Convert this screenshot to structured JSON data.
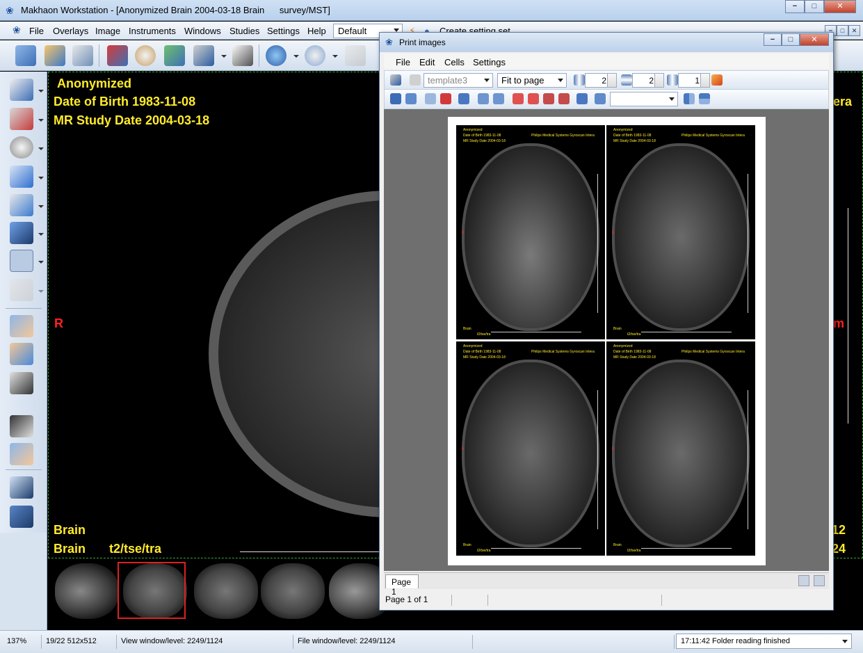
{
  "window": {
    "title": "Makhaon Workstation - [Anonymized Brain 2004-03-18 Brain      survey/MST]",
    "min": "−",
    "max": "□",
    "close": "✕"
  },
  "menu": {
    "file": "File",
    "overlays": "Overlays",
    "image": "Image",
    "instruments": "Instruments",
    "windows": "Windows",
    "studies": "Studies",
    "settings": "Settings",
    "help": "Help",
    "layout_value": "Default",
    "create_setting_set": "Create setting set"
  },
  "overlay": {
    "name": "Anonymized",
    "dob": "Date of Birth 1983-11-08",
    "study_date": "MR Study Date 2004-03-18",
    "orientation_left": "R",
    "orientation_right": "m",
    "body_part": "Brain",
    "series_body": "Brain",
    "series_desc": "t2/tse/tra",
    "right_top": "era",
    "right_mid": "12",
    "right_bottom": "24"
  },
  "status": {
    "zoom": "137%",
    "image_info": "19/22 512x512",
    "view_wl": "View window/level: 2249/1124",
    "file_wl": "File window/level: 2249/1124",
    "log": "17:11:42 Folder reading finished"
  },
  "print_dialog": {
    "title": "Print images",
    "menu": {
      "file": "File",
      "edit": "Edit",
      "cells": "Cells",
      "settings": "Settings"
    },
    "template": "template3",
    "fit": "Fit to page",
    "cols": "2",
    "rows": "2",
    "spacing": "1",
    "tab": "Page 1",
    "page_status": "Page 1 of 1",
    "cell_text": {
      "name": "Anonymized",
      "dob": "Date of Birth 1983-11-08",
      "study": "MR Study Date 2004-03-18",
      "vendor": "Philips Medical Systems Gyroscan Intera",
      "r": "R",
      "brain": "Brain",
      "desc": "t2/tse/tra"
    }
  },
  "colors": {
    "overlay_text": "#ffeb2a",
    "orientation": "#ff2121",
    "selected_thumb": "#e02020"
  }
}
